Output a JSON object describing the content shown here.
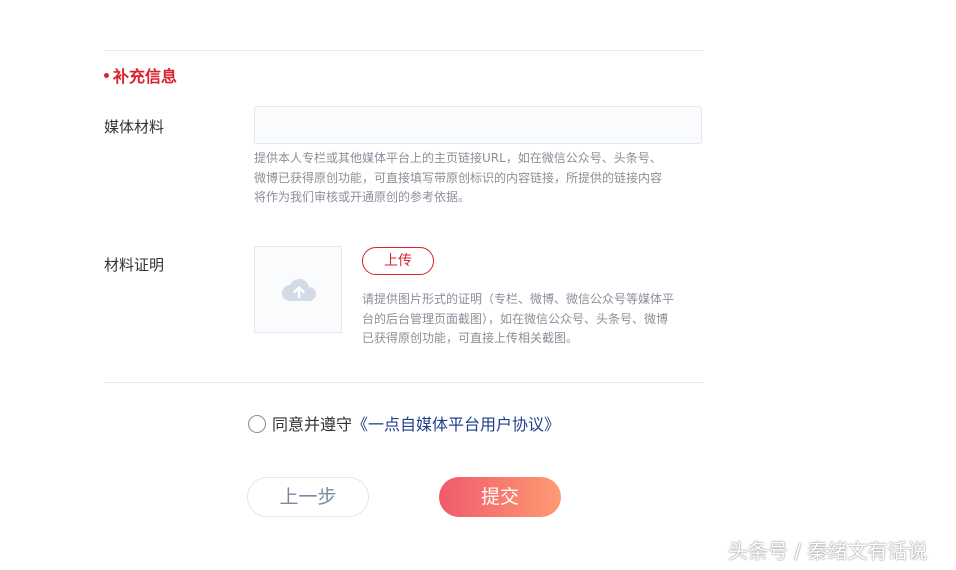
{
  "section": {
    "title": "补充信息"
  },
  "media_material": {
    "label": "媒体材料",
    "value": "",
    "placeholder": "",
    "hint_lines": [
      "提供本人专栏或其他媒体平台上的主页链接URL，如在微信公众号、头条号、",
      "微博已获得原创功能，可直接填写带原创标识的内容链接，所提供的链接内容",
      "将作为我们审核或开通原创的参考依据。"
    ]
  },
  "material_proof": {
    "label": "材料证明",
    "upload_label": "上传",
    "upload_icon": "cloud-upload-icon",
    "hint_lines": [
      "请提供图片形式的证明（专栏、微博、微信公众号等媒体平",
      "台的后台管理页面截图），如在微信公众号、头条号、微博",
      "已获得原创功能，可直接上传相关截图。"
    ]
  },
  "agreement": {
    "checked": false,
    "prefix": "同意并遵守",
    "link": "《一点自媒体平台用户协议》"
  },
  "actions": {
    "prev_label": "上一步",
    "submit_label": "提交"
  },
  "watermark": "头条号 / 秦绪文有话说",
  "colors": {
    "accent_red": "#d9232d",
    "submit_gradient_start": "#f05a6b",
    "submit_gradient_end": "#ff9a72",
    "link_blue": "#1f3f8a"
  }
}
